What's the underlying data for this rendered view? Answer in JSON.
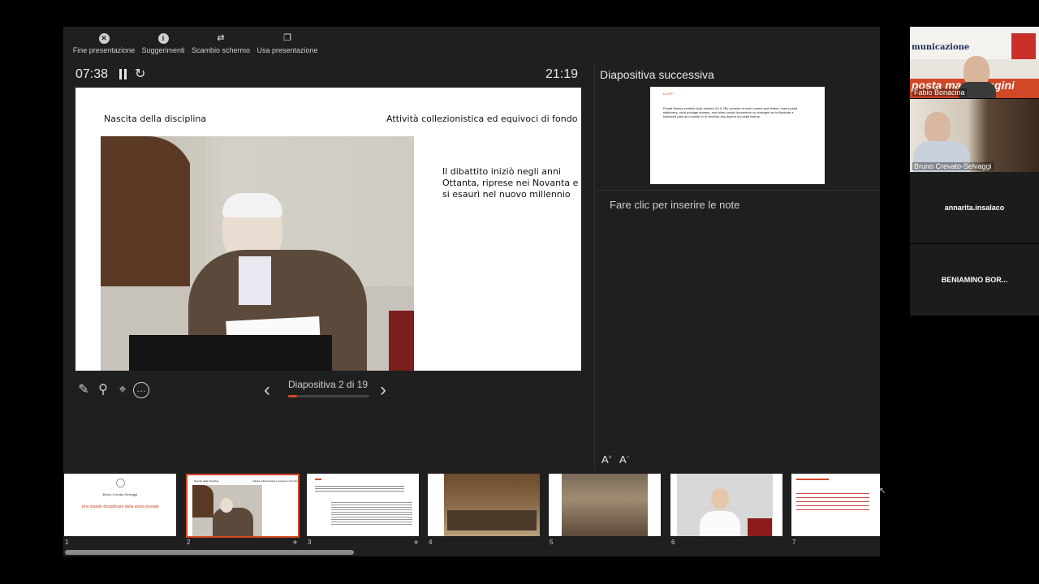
{
  "toolbar": {
    "end_label": "Fine presentazione",
    "tips_label": "Suggerimenti",
    "swap_label": "Scambio schermo",
    "use_label": "Usa presentazione"
  },
  "timers": {
    "elapsed": "07:38",
    "clock": "21:19"
  },
  "slide": {
    "heading_left": "Nascita della disciplina",
    "heading_right": "Attività collezionistica ed equivoci di fondo",
    "body": [
      "Il dibattito iniziò negli anni",
      "Ottanta, riprese nei Novanta e",
      "si esaurì nel nuovo millennio"
    ]
  },
  "next_panel": {
    "title": "Diapositiva successiva",
    "slide_tag": "La FIP",
    "slide_text": "Postal History exhibits (sub-classes 2A & 2B) consists of used covers and letters, used postal stationery, used postage stamps, and other postal documents so arranged as to illustrate a balanced plan as a whole or to develop any aspect of postal history."
  },
  "notes": {
    "placeholder": "Fare clic per inserire le note"
  },
  "nav": {
    "slide_counter": "Diapositiva 2 di 19",
    "progress": 0.1053
  },
  "thumbnails": [
    {
      "num": "1",
      "line1": "Bruno Crevato-Selvaggi",
      "line2": "Uno statuto disciplinare della storia postale",
      "starred": false
    },
    {
      "num": "2",
      "head_left": "Nascita della disciplina",
      "head_right": "Attività collezionistica ed equivoci di fondo",
      "selected": true,
      "starred": true
    },
    {
      "num": "3",
      "starred": true
    },
    {
      "num": "4",
      "starred": false
    },
    {
      "num": "5",
      "starred": false
    },
    {
      "num": "6",
      "starred": false
    },
    {
      "num": "7",
      "starred": false
    }
  ],
  "participants": [
    {
      "name": "Fabio Bonacina",
      "banner1": "municazione",
      "banner2": "posta ma immagini"
    },
    {
      "name": "Bruno Crevato-Selvaggi"
    },
    {
      "name": "annarita.insalaco"
    },
    {
      "name": "BENIAMINO  BOR..."
    }
  ],
  "colors": {
    "accent": "#d24726",
    "panel": "#1f1f1f",
    "background": "#000000"
  }
}
